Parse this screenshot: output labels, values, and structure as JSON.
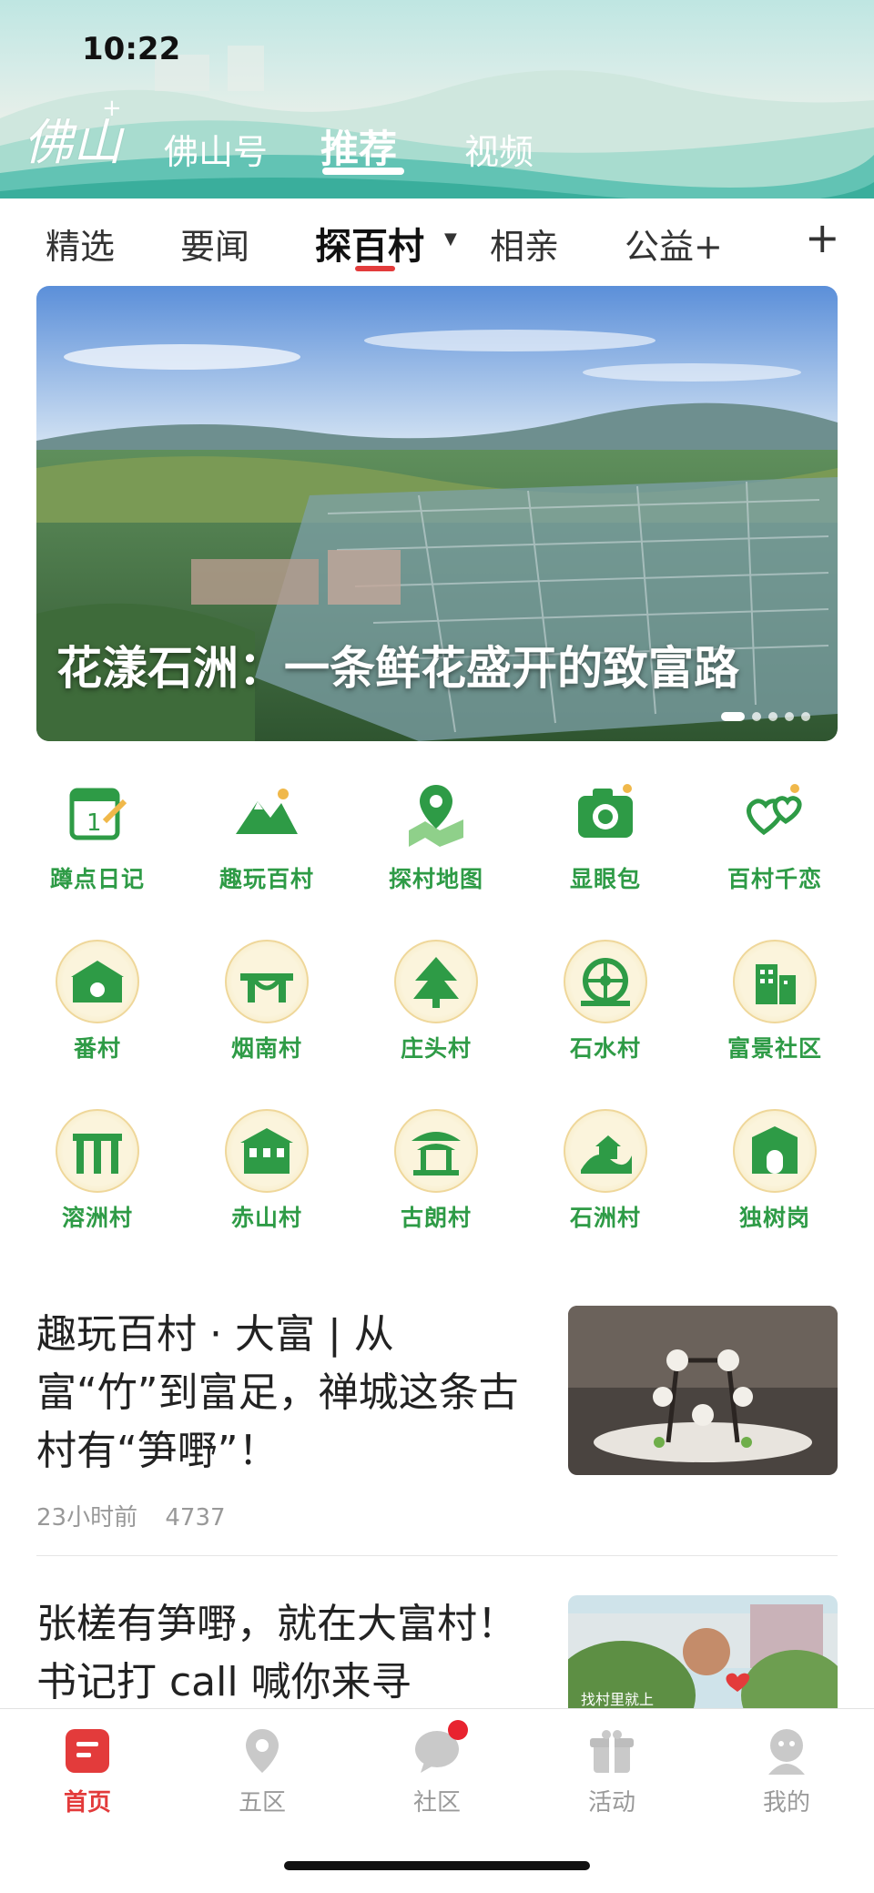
{
  "status_bar": {
    "time": "10:22"
  },
  "header": {
    "brand": "佛山",
    "brand_plus": "+",
    "tabs": [
      "佛山号",
      "推荐",
      "视频"
    ],
    "active_tab": "推荐"
  },
  "channels": {
    "items": [
      "精选",
      "要闻",
      "探百村",
      "相亲",
      "公益+"
    ],
    "active": "探百村",
    "add_label": "+"
  },
  "hero": {
    "caption": "花漾石洲：一条鲜花盛开的致富路",
    "slide_count": 5,
    "active_slide": 1
  },
  "grid": {
    "rows": [
      [
        {
          "label": "蹲点日记",
          "icon": "calendar-pen-icon"
        },
        {
          "label": "趣玩百村",
          "icon": "mountain-icon"
        },
        {
          "label": "探村地图",
          "icon": "map-pin-icon"
        },
        {
          "label": "显眼包",
          "icon": "camera-icon"
        },
        {
          "label": "百村千恋",
          "icon": "hearts-icon"
        }
      ],
      [
        {
          "label": "番村",
          "icon": "village-gate-icon"
        },
        {
          "label": "烟南村",
          "icon": "bridge-icon"
        },
        {
          "label": "庄头村",
          "icon": "pine-tree-icon"
        },
        {
          "label": "石水村",
          "icon": "waterwheel-icon"
        },
        {
          "label": "富景社区",
          "icon": "building-icon"
        }
      ],
      [
        {
          "label": "溶洲村",
          "icon": "archway-icon"
        },
        {
          "label": "赤山村",
          "icon": "hall-icon"
        },
        {
          "label": "古朗村",
          "icon": "pavilion-icon"
        },
        {
          "label": "石洲村",
          "icon": "house-hill-icon"
        },
        {
          "label": "独树岗",
          "icon": "tower-gate-icon"
        }
      ]
    ]
  },
  "news": [
    {
      "title": "趣玩百村 · 大富 | 从富“竹”到富足，禅城这条古村有“笋嘢”！",
      "time": "23小时前",
      "views": "4737"
    },
    {
      "title": "张槎有笋嘢，就在大富村！书记打 call 喊你来寻",
      "thumb_text": "找村里就上"
    }
  ],
  "bottom_nav": {
    "items": [
      {
        "label": "首页",
        "icon": "home-icon"
      },
      {
        "label": "五区",
        "icon": "location-icon"
      },
      {
        "label": "社区",
        "icon": "chat-bubble-icon"
      },
      {
        "label": "活动",
        "icon": "gift-icon"
      },
      {
        "label": "我的",
        "icon": "profile-icon"
      }
    ],
    "active": "首页"
  },
  "colors": {
    "accent_red": "#e33b3b",
    "icon_green": "#2e9b46",
    "header_teal": "#bfe6e2"
  }
}
